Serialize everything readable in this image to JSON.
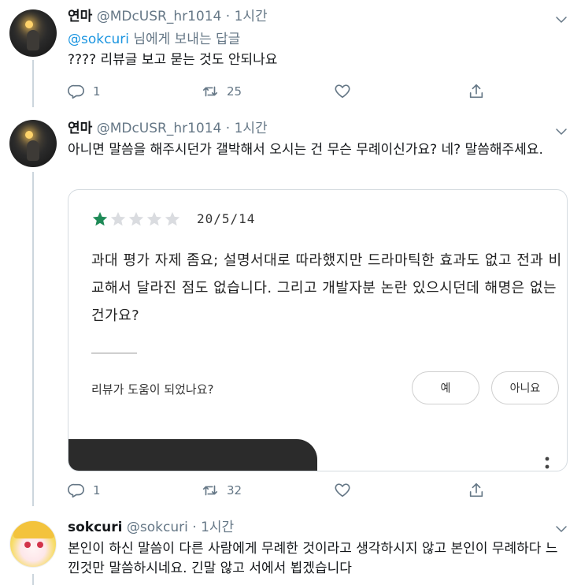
{
  "tweets": [
    {
      "name": "연마",
      "handle": "@MDcUSR_hr1014",
      "dot": "·",
      "time": "1시간",
      "replying_mention": "@sokcuri",
      "replying_suffix": " 님에게 보내는 답글",
      "text": "???? 리뷰글 보고 묻는 것도 안되나요",
      "reply_count": "1",
      "retweet_count": "25"
    },
    {
      "name": "연마",
      "handle": "@MDcUSR_hr1014",
      "dot": "·",
      "time": "1시간",
      "text": "아니면 말씀을 해주시던가 갤박해서 오시는 건 무슨 무례이신가요? 네? 말씀해주세요.",
      "reply_count": "1",
      "retweet_count": "32",
      "card": {
        "rating": 1,
        "rating_max": 5,
        "date": "20/5/14",
        "review": "과대 평가 자제 좀요; 설명서대로 따라했지만 드라마틱한 효과도 없고 전과 비교해서 달라진 점도 없습니다. 그리고 개발자분 논란 있으시던데 해명은 없는건가요?",
        "helpful_question": "리뷰가 도움이 되었나요?",
        "yes_label": "예",
        "no_label": "아니요"
      }
    },
    {
      "name": "sokcuri",
      "handle": "@sokcuri",
      "dot": "·",
      "time": "1시간",
      "text": "본인이 하신 말씀이 다른 사람에게 무례한 것이라고 생각하시지 않고 본인이 무례하다 느낀것만 말씀하시네요. 긴말 않고 서에서 뵙겠습니다"
    }
  ],
  "colors": {
    "accent": "#1b95e0",
    "muted": "#657786",
    "star_filled": "#1e8a57",
    "star_empty": "#dadce0"
  },
  "icons": [
    "chevron-down-icon",
    "reply-icon",
    "retweet-icon",
    "like-icon",
    "share-icon",
    "star-icon",
    "more-vertical-icon"
  ]
}
